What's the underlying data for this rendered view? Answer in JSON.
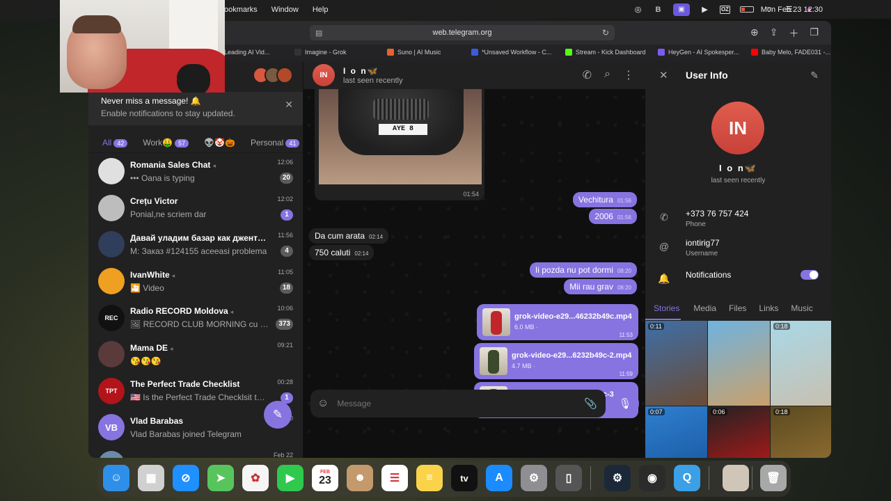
{
  "menubar": {
    "menus": [
      "ookmarks",
      "Window",
      "Help"
    ],
    "clock": "Mon Feb 23  12:30",
    "status_icons": [
      "creative-cloud-icon",
      "b-icon",
      "screen-share-icon",
      "play-icon",
      "oz-icon",
      "battery-icon",
      "wifi-icon",
      "control-center-icon",
      "siri-icon"
    ]
  },
  "browser": {
    "url": "web.telegram.org",
    "tabs": [
      {
        "label": "Leading AI Vid...",
        "color": "#444"
      },
      {
        "label": "Imagine - Grok",
        "color": "#333"
      },
      {
        "label": "Suno | AI Music",
        "color": "#e8622c"
      },
      {
        "label": "*Unsaved Workflow - C...",
        "color": "#3b5bdb"
      },
      {
        "label": "Stream - Kick Dashboard",
        "color": "#53fc18"
      },
      {
        "label": "HeyGen - AI Spokesper...",
        "color": "#7a5cf0"
      },
      {
        "label": "Baby Melo, FADE031 -...",
        "color": "#ff0000"
      }
    ]
  },
  "notification_banner": {
    "title": "Never miss a message! 🔔",
    "subtitle": "Enable notifications to stay updated."
  },
  "folders": [
    {
      "label": "All",
      "count": "42"
    },
    {
      "label": "Work🤑",
      "count": "57"
    },
    {
      "label": "👽🤡🎃",
      "count": ""
    },
    {
      "label": "Personal",
      "count": "41"
    }
  ],
  "chats": [
    {
      "name": "Romania Sales Chat",
      "message": "••• Oana is typing",
      "time": "12:06",
      "count": "20",
      "count_style": "grey",
      "avatar_color": "#e0e0e0",
      "avatar_text": ""
    },
    {
      "name": "Crețu Victor",
      "message": "Ponial,ne scriem dar",
      "time": "12:02",
      "count": "1",
      "count_style": "purple",
      "avatar_color": "#bdbdbd",
      "avatar_text": ""
    },
    {
      "name": "Давай уладим базар как джентельмены",
      "message": "M: Заказ #124155 aceeasi problema",
      "time": "11:56",
      "count": "4",
      "count_style": "grey",
      "avatar_color": "#2f3e5a",
      "avatar_text": ""
    },
    {
      "name": "IvanWhite",
      "message": "🎦 Video",
      "time": "11:05",
      "count": "18",
      "count_style": "grey",
      "avatar_color": "#f0a020",
      "avatar_text": ""
    },
    {
      "name": "Radio RECORD Moldova",
      "message": "🖼 RECORD CLUB MORNING cu DJ ...",
      "time": "10:06",
      "count": "373",
      "count_style": "grey",
      "avatar_color": "#111111",
      "avatar_text": "REC"
    },
    {
      "name": "Mama DE",
      "message": "😘😘😘",
      "time": "09:21",
      "count": "",
      "count_style": "",
      "avatar_color": "#5a3a3a",
      "avatar_text": ""
    },
    {
      "name": "The Perfect Trade Checklist",
      "message": "🇺🇸 Is the Perfect Trade Checklsit the s...",
      "time": "00:28",
      "count": "1",
      "count_style": "purple",
      "avatar_color": "#b3141a",
      "avatar_text": "TPT"
    },
    {
      "name": "Vlad Barabas",
      "message": "Vlad Barabas joined Telegram",
      "time": "00:00",
      "count": "",
      "count_style": "",
      "avatar_color": "#8774e1",
      "avatar_text": "VB"
    },
    {
      "name": "Shancaofficial",
      "message": "",
      "time": "Feb 22",
      "count": "",
      "count_style": "",
      "avatar_color": "#6a8caa",
      "avatar_text": ""
    }
  ],
  "conversation": {
    "name": "I o n🦋",
    "status": "last seen recently",
    "avatar_initials": "IN",
    "photo_time": "01:54",
    "plate_text": "AYE  8",
    "messages": [
      {
        "text": "Vechitura",
        "time": "01:56",
        "dir": "out"
      },
      {
        "text": "2006",
        "time": "01:56",
        "dir": "out"
      },
      {
        "text": "Da cum arata",
        "time": "02:14",
        "dir": "in"
      },
      {
        "text": "750 caluti",
        "time": "02:14",
        "dir": "in"
      },
      {
        "text": "Ii pozda nu pot dormi",
        "time": "08:20",
        "dir": "out"
      },
      {
        "text": "Mii rau grav",
        "time": "08:20",
        "dir": "out"
      }
    ],
    "files": [
      {
        "name": "grok-video-e29...46232b49c.mp4",
        "size": "6.0 MB ·",
        "time": "11:53",
        "color": "#c0262a"
      },
      {
        "name": "grok-video-e29...6232b49c-2.mp4",
        "size": "4.7 MB ·",
        "time": "11:59",
        "color": "#3c4a2c"
      },
      {
        "name": "grok-video-e29...6232b49c-3.mp4",
        "size": "7.2 MB ·",
        "time": "12:21",
        "color": "#a02828"
      }
    ],
    "composer_placeholder": "Message"
  },
  "user_info": {
    "title": "User Info",
    "initials": "IN",
    "name": "I o n🦋",
    "status": "last seen recently",
    "phone": "+373 76 757 424",
    "phone_label": "Phone",
    "username": "iontirig77",
    "username_label": "Username",
    "notifications_label": "Notifications",
    "notifications_on": true,
    "tabs": [
      "Stories",
      "Media",
      "Files",
      "Links",
      "Music"
    ],
    "stories": [
      {
        "duration": "0:11",
        "colors": [
          "#3d6fa8",
          "#6b4b34"
        ]
      },
      {
        "duration": "",
        "colors": [
          "#6fb3e0",
          "#c9a06a"
        ]
      },
      {
        "duration": "0:18",
        "colors": [
          "#a8d8e8",
          "#c8c0b0"
        ]
      },
      {
        "duration": "0:07",
        "colors": [
          "#2f7fd0",
          "#1d5fa8"
        ]
      },
      {
        "duration": "0:06",
        "colors": [
          "#222",
          "#a01a1a"
        ]
      },
      {
        "duration": "0:18",
        "colors": [
          "#5a4a20",
          "#8a6a30"
        ]
      }
    ]
  },
  "dock": {
    "calendar_month": "FEB",
    "calendar_day": "23",
    "apps": [
      "finder-icon",
      "launchpad-icon",
      "safari-icon",
      "maps-icon",
      "photos-icon",
      "facetime-icon",
      "calendar-icon",
      "contacts-icon",
      "reminders-icon",
      "notes-icon",
      "appletv-icon",
      "appstore-icon",
      "settings-icon",
      "iphone-mirroring-icon",
      "steam-icon",
      "obs-icon",
      "quicktime-icon",
      "image-thumb-icon",
      "trash-icon"
    ],
    "appletv_label": "tv"
  }
}
